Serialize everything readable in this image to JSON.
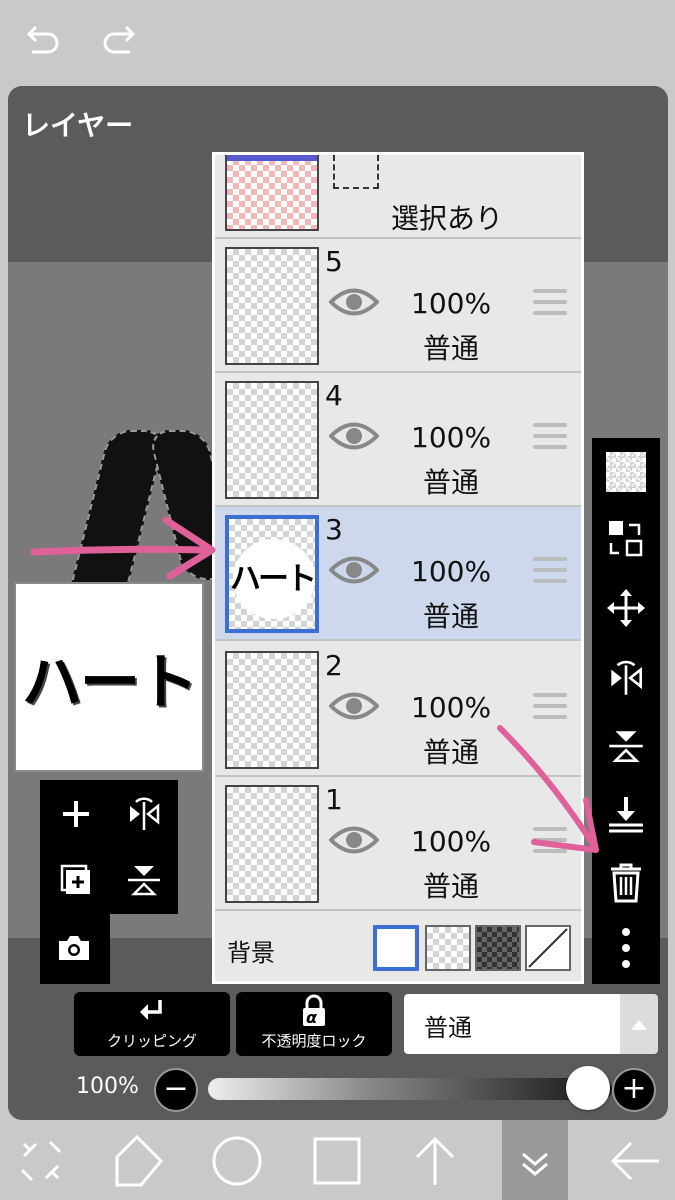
{
  "panel": {
    "title": "レイヤー"
  },
  "preview": {
    "text": "ハート"
  },
  "layers": [
    {
      "number": "5",
      "opacity": "100%",
      "blend": "普通",
      "selected": false,
      "thumb_text": ""
    },
    {
      "number": "4",
      "opacity": "100%",
      "blend": "普通",
      "selected": false,
      "thumb_text": ""
    },
    {
      "number": "3",
      "opacity": "100%",
      "blend": "普通",
      "selected": true,
      "thumb_text": "ハート"
    },
    {
      "number": "2",
      "opacity": "100%",
      "blend": "普通",
      "selected": false,
      "thumb_text": ""
    },
    {
      "number": "1",
      "opacity": "100%",
      "blend": "普通",
      "selected": false,
      "thumb_text": ""
    }
  ],
  "selection_layer": {
    "label": "選択あり"
  },
  "background": {
    "label": "背景"
  },
  "bottom_controls": {
    "clipping_label": "クリッピング",
    "alpha_lock_label": "不透明度ロック",
    "alpha_symbol": "α",
    "blend_mode": "普通",
    "opacity_value": "100%",
    "opacity_level": 1.0,
    "minus": "−",
    "plus": "+"
  },
  "colors": {
    "selection_blue": "#3b6fd4",
    "selected_row": "#cdd8ec",
    "annotation_arrow": "#e0609a"
  }
}
